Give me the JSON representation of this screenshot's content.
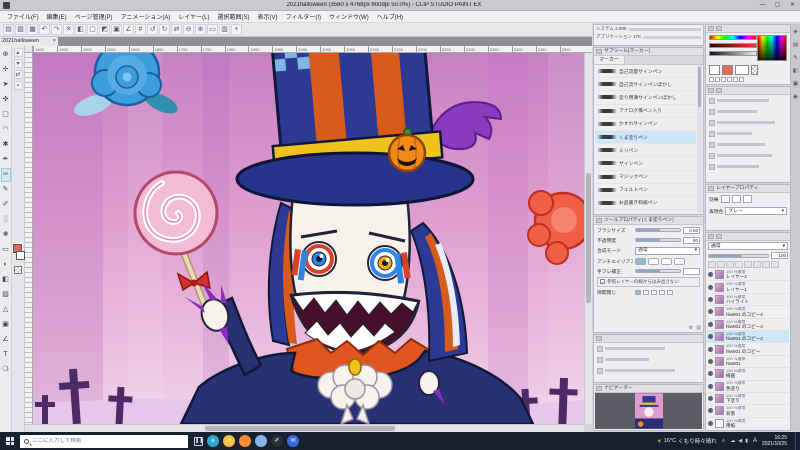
{
  "window": {
    "title": "2021halloween (3560 x 4768px 600dpi 50.0%) - CLIP STUDIO PAINT EX",
    "minimize": "—",
    "maximize": "▢",
    "close": "✕"
  },
  "menu": {
    "items": [
      "ファイル(F)",
      "編集(E)",
      "ページ管理(P)",
      "アニメーション(A)",
      "レイヤー(L)",
      "選択範囲(S)",
      "表示(V)",
      "フィルター(I)",
      "ウィンドウ(W)",
      "ヘルプ(H)"
    ]
  },
  "toolbar": {
    "icons": [
      {
        "name": "new-file-icon",
        "glyph": "▤"
      },
      {
        "name": "open-icon",
        "glyph": "▧"
      },
      {
        "name": "save-icon",
        "glyph": "▦"
      },
      {
        "name": "undo-icon",
        "glyph": "↶"
      },
      {
        "name": "redo-icon",
        "glyph": "↷"
      },
      {
        "name": "delete-icon",
        "glyph": "✕"
      },
      {
        "name": "fill-icon",
        "glyph": "◧"
      },
      {
        "name": "deselect-icon",
        "glyph": "▢"
      },
      {
        "name": "invert-selection-icon",
        "glyph": "◩"
      },
      {
        "name": "selection-border-icon",
        "glyph": "▣"
      },
      {
        "name": "snap-ruler-icon",
        "glyph": "∠"
      },
      {
        "name": "snap-grid-icon",
        "glyph": "#"
      },
      {
        "name": "rotate-left-icon",
        "glyph": "↺"
      },
      {
        "name": "rotate-right-icon",
        "glyph": "↻"
      },
      {
        "name": "flip-horizontal-icon",
        "glyph": "⇄"
      },
      {
        "name": "zoom-out-icon",
        "glyph": "⊖"
      },
      {
        "name": "zoom-in-icon",
        "glyph": "⊕"
      },
      {
        "name": "fit-screen-icon",
        "glyph": "▭"
      },
      {
        "name": "grid-icon",
        "glyph": "▥"
      },
      {
        "name": "guide-icon",
        "glyph": "+"
      }
    ]
  },
  "tab": {
    "label": "2021halloween",
    "close": "×"
  },
  "ruler": {
    "ticks": [
      "1400",
      "1450",
      "1500",
      "1550",
      "1600",
      "1650",
      "1700",
      "1750",
      "1800",
      "1850",
      "1900",
      "1950",
      "2000",
      "2050",
      "2100",
      "2150",
      "2200",
      "2250",
      "2300",
      "2350",
      "2400",
      "2450",
      "2500"
    ]
  },
  "tools": {
    "items": [
      {
        "name": "zoom-tool",
        "glyph": "⊕"
      },
      {
        "name": "move-tool",
        "glyph": "✛"
      },
      {
        "name": "operate-tool",
        "glyph": "➤"
      },
      {
        "name": "layer-move-tool",
        "glyph": "✜"
      },
      {
        "name": "selection-tool",
        "glyph": "▢"
      },
      {
        "name": "lasso-tool",
        "glyph": "◠"
      },
      {
        "name": "wand-tool",
        "glyph": "✱"
      },
      {
        "name": "eyedropper-tool",
        "glyph": "✒"
      },
      {
        "name": "pen-tool",
        "glyph": "✑",
        "selected": true
      },
      {
        "name": "pencil-tool",
        "glyph": "✎"
      },
      {
        "name": "brush-tool",
        "glyph": "✐"
      },
      {
        "name": "airbrush-tool",
        "glyph": "░"
      },
      {
        "name": "decoration-tool",
        "glyph": "❀"
      },
      {
        "name": "eraser-tool",
        "glyph": "▭"
      },
      {
        "name": "blend-tool",
        "glyph": "◐"
      },
      {
        "name": "fill-tool",
        "glyph": "◧"
      },
      {
        "name": "gradient-tool",
        "glyph": "▨"
      },
      {
        "name": "figure-tool",
        "glyph": "△"
      },
      {
        "name": "frame-tool",
        "glyph": "▣"
      },
      {
        "name": "ruler-tool",
        "glyph": "∠"
      },
      {
        "name": "text-tool",
        "glyph": "T"
      },
      {
        "name": "balloon-tool",
        "glyph": "❍"
      }
    ],
    "extra_icons": [
      {
        "name": "up-icon",
        "glyph": "▴"
      },
      {
        "name": "down-icon",
        "glyph": "▾"
      },
      {
        "name": "swap-icon",
        "glyph": "⇄"
      },
      {
        "name": "reset-icon",
        "glyph": "▪"
      }
    ],
    "main_color": "#e2685a",
    "sub_color": "#ffffff"
  },
  "memory_info": {
    "line1": "システム 2.99K",
    "line2": "アプリケーション 17K"
  },
  "subtool": {
    "title": "サブツール[マーカー]",
    "group_tab": "マーカー",
    "items": [
      {
        "label": "自己流量サインペン"
      },
      {
        "label": "自己流サインペンぼかし"
      },
      {
        "label": "塗り用薄サインペンぼかし"
      },
      {
        "label": "アナログ風ペン入り"
      },
      {
        "label": "かすれサインペン"
      },
      {
        "label": "くま塗りペン",
        "selected": true
      },
      {
        "label": "ミリペン"
      },
      {
        "label": "サインペン"
      },
      {
        "label": "マジックペン"
      },
      {
        "label": "フェルトペン"
      },
      {
        "label": "お品書き和紙ペン"
      }
    ]
  },
  "tool_property": {
    "title": "ツールプロパティ[くま塗りペン]",
    "brush_size_label": "ブラシサイズ",
    "brush_size_value": "0.60",
    "opacity_label": "不透明度",
    "opacity_value": "80",
    "blend_label": "合成モード",
    "blend_value": "通常",
    "antialias_label": "アンチエイリアス",
    "stabilize_label": "手ブレ補正",
    "ref_label": "参照レイヤーの線からはみ出さない",
    "gap_label": "隙間閉じ"
  },
  "navigator": {
    "title": "ナビゲーター"
  },
  "layer_property": {
    "title": "レイヤープロパティ",
    "effect_label": "効果",
    "expression_label": "表現色",
    "expression_value": "グレー"
  },
  "layers": {
    "blend_mode": "通常",
    "opacity_value": "100",
    "rows": [
      {
        "info": "100 %通常",
        "name": "レイヤー2"
      },
      {
        "info": "100 %通常",
        "name": "レイヤー1"
      },
      {
        "info": "100 %通常",
        "name": "ハイライト"
      },
      {
        "info": "100 %通常",
        "name": "hlw001 のコピー4"
      },
      {
        "info": "100 %通常",
        "name": "hlw001 のコピー3"
      },
      {
        "info": "100 %通常",
        "name": "hlw001 のコピー2",
        "selected": true
      },
      {
        "info": "100 %通常",
        "name": "hlw001 のコピー"
      },
      {
        "info": "100 %通常",
        "name": "hlw001"
      },
      {
        "info": "100 %通常",
        "name": "線画"
      },
      {
        "info": "100 %通常",
        "name": "色塗り"
      },
      {
        "info": "100 %通常",
        "name": "下塗り"
      },
      {
        "info": "100 %通常",
        "name": "背景"
      },
      {
        "info": "100 %通常",
        "name": "用紙",
        "white": true
      }
    ]
  },
  "dock_strip": {
    "icons": [
      "◈",
      "▤",
      "✎",
      "◧",
      "▣",
      "◉"
    ]
  },
  "taskbar": {
    "search_placeholder": "ここに入力して検索",
    "weather_icon": "☀",
    "weather_temp": "16°C",
    "weather_text": "くもり時々晴れ",
    "time": "16:25",
    "date": "2021/10/25",
    "ime_label": "A",
    "tray_chevron": "∧",
    "tray_icons": [
      "☁",
      "◀",
      "▮"
    ],
    "app_icons": [
      {
        "name": "task-view-button",
        "glyph": "❚❚",
        "color": "transparent",
        "tv": true
      },
      {
        "name": "edge-browser-icon",
        "glyph": "e",
        "color": "#2ea7c9"
      },
      {
        "name": "file-explorer-icon",
        "glyph": "▱",
        "color": "#f2c14b"
      },
      {
        "name": "firefox-browser-icon",
        "glyph": "",
        "color": "#ff8c2e"
      },
      {
        "name": "chrome-browser-icon",
        "glyph": "",
        "color": "#8ab4e8"
      },
      {
        "name": "clip-studio-icon",
        "glyph": "✐",
        "color": "#2a3038"
      },
      {
        "name": "mail-icon",
        "glyph": "✉",
        "color": "#3a6ad9"
      }
    ]
  },
  "colors": {
    "selection_highlight": "#cfe8f8",
    "dock_bg": "#d4d4da",
    "taskbar_bg": "#16202e",
    "main_color": "#e2685a",
    "sky_top": "#c77fc4",
    "sky_bottom": "#f0d4e9",
    "hat_blue": "#2c3a96",
    "hat_orange": "#d95b1c",
    "band_yellow": "#f2c21c",
    "pumpkin_orange": "#f28a1a",
    "claw_purple": "#8a2ac0",
    "lollipop_pink": "#f4bcd4",
    "cross_purple": "#4b2a66"
  }
}
